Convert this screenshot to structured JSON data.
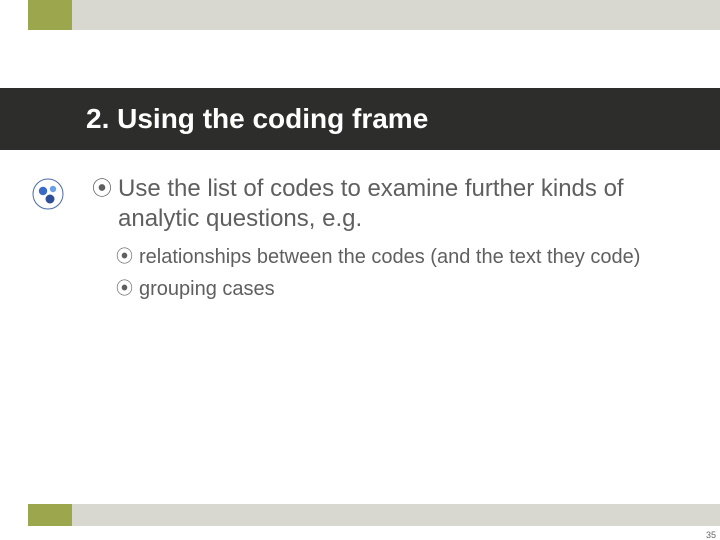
{
  "slide": {
    "title": "2. Using the coding frame",
    "page_number": "35"
  },
  "bullets": {
    "main": "Use the list of codes to examine further kinds of analytic questions, e.g.",
    "sub1": "relationships between the codes (and the text they code)",
    "sub2": "grouping cases"
  },
  "colors": {
    "accent": "#9ba64d",
    "gray_band": "#d8d8d0",
    "title_bg": "#2d2d2b",
    "body_text": "#5f5f5f"
  }
}
